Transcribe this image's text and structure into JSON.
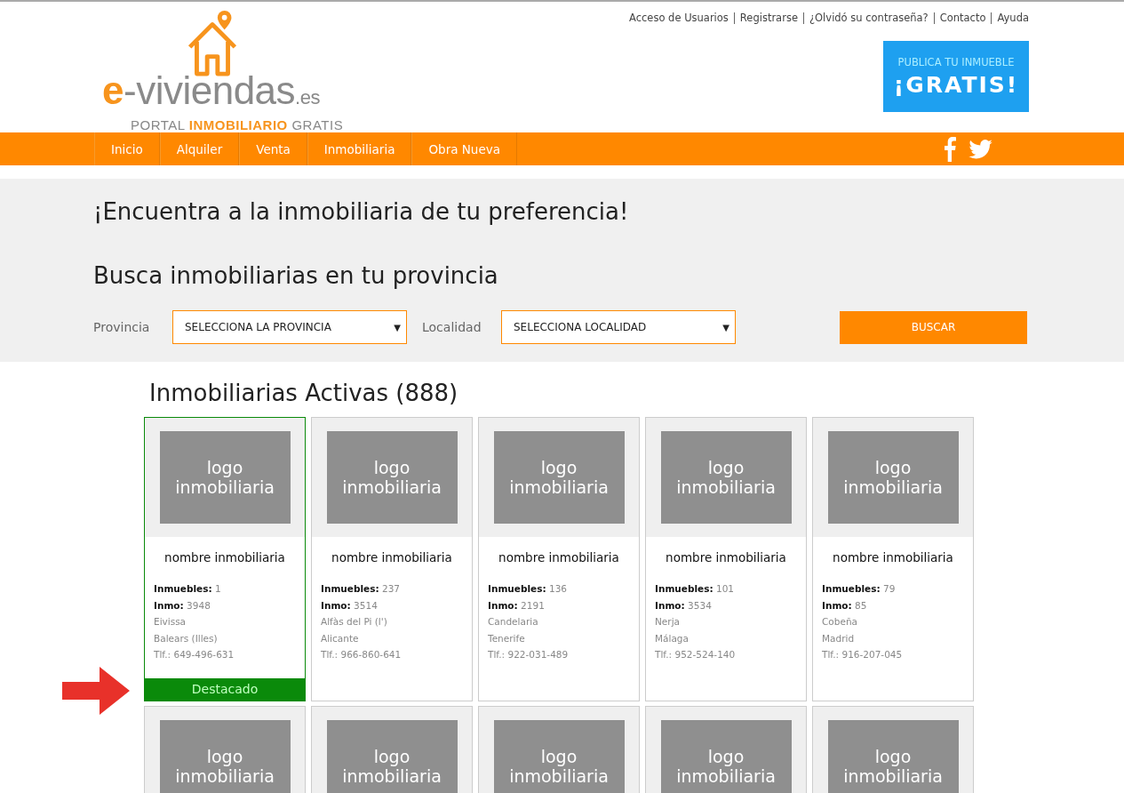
{
  "logo": {
    "letter": "e",
    "name": "-viviendas",
    "tld": ".es",
    "tagline": "PORTAL **INMOBILIARIO** GRATIS"
  },
  "top_links": [
    "Acceso de Usuarios",
    "Registrarse",
    "¿Olvidó su contraseña?",
    "Contacto",
    "Ayuda"
  ],
  "promo": {
    "line1": "PUBLICA TU INMUEBLE",
    "line2": "¡GRATIS!"
  },
  "nav": [
    "Inicio",
    "Alquiler",
    "Venta",
    "Inmobiliaria",
    "Obra Nueva"
  ],
  "search": {
    "heading": "¡Encuentra a la inmobiliaria de tu preferencia!",
    "subheading": "Busca inmobiliarias en tu provincia",
    "fields": [
      {
        "label": "Provincia",
        "value": "SELECCIONA LA PROVINCIA",
        "caret": "▼"
      },
      {
        "label": "Localidad",
        "value": "SELECCIONA LOCALIDAD",
        "caret": "▼"
      }
    ],
    "button": "BUSCAR"
  },
  "results_title": "Inmobiliarias Activas (888)",
  "cards": [
    {
      "logo_text": "logo inmobiliaria",
      "name": "nombre inmobiliaria",
      "inmuebles_label": "Inmuebles:",
      "inmuebles": "1",
      "inmo_label": "Inmo:",
      "inmo": "3948",
      "city": "Eivissa",
      "province": "Balears (Illes)",
      "phone": "Tlf.: 649-496-631",
      "featured": true,
      "badge": "Destacado"
    },
    {
      "logo_text": "logo inmobiliaria",
      "name": "nombre inmobiliaria",
      "inmuebles_label": "Inmuebles:",
      "inmuebles": "237",
      "inmo_label": "Inmo:",
      "inmo": "3514",
      "city": "Alfàs del Pi (l')",
      "province": "Alicante",
      "phone": "Tlf.: 966-860-641",
      "featured": false
    },
    {
      "logo_text": "logo inmobiliaria",
      "name": "nombre inmobiliaria",
      "inmuebles_label": "Inmuebles:",
      "inmuebles": "136",
      "inmo_label": "Inmo:",
      "inmo": "2191",
      "city": "Candelaria",
      "province": "Tenerife",
      "phone": "Tlf.: 922-031-489",
      "featured": false
    },
    {
      "logo_text": "logo inmobiliaria",
      "name": "nombre inmobiliaria",
      "inmuebles_label": "Inmuebles:",
      "inmuebles": "101",
      "inmo_label": "Inmo:",
      "inmo": "3534",
      "city": "Nerja",
      "province": "Málaga",
      "phone": "Tlf.: 952-524-140",
      "featured": false
    },
    {
      "logo_text": "logo inmobiliaria",
      "name": "nombre inmobiliaria",
      "inmuebles_label": "Inmuebles:",
      "inmuebles": "79",
      "inmo_label": "Inmo:",
      "inmo": "85",
      "city": "Cobeña",
      "province": "Madrid",
      "phone": "Tlf.: 916-207-045",
      "featured": false
    },
    {
      "logo_text": "logo inmobiliaria"
    },
    {
      "logo_text": "logo inmobiliaria"
    },
    {
      "logo_text": "logo inmobiliaria"
    },
    {
      "logo_text": "logo inmobiliaria"
    },
    {
      "logo_text": "logo inmobiliaria"
    }
  ]
}
